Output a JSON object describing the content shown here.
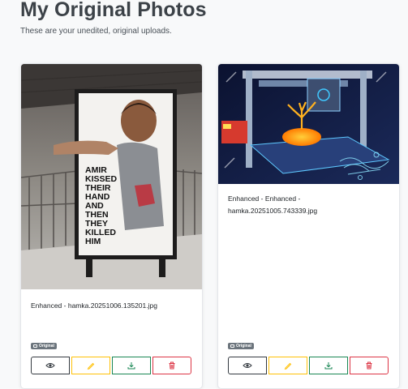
{
  "page": {
    "title": "My Original Photos",
    "subtitle": "These are your unedited, original uploads."
  },
  "photos": [
    {
      "filename": "Enhanced - hamka.20251006.135201.jpg",
      "badge": "Original",
      "poster_text": [
        "AMIR",
        "KISSED",
        "THEIR",
        "HAND",
        "AND",
        "THEN",
        "THEY",
        "KILLED",
        "HIM"
      ]
    },
    {
      "filename": "Enhanced - Enhanced - hamka.20251005.743339.jpg",
      "badge": "Original"
    }
  ],
  "actions": {
    "view_icon": "eye-icon",
    "edit_icon": "pencil-icon",
    "download_icon": "download-icon",
    "delete_icon": "trash-icon"
  },
  "colors": {
    "view": "#343a40",
    "edit": "#ffc107",
    "download": "#198754",
    "delete": "#dc3545",
    "badge": "#6c757d"
  }
}
